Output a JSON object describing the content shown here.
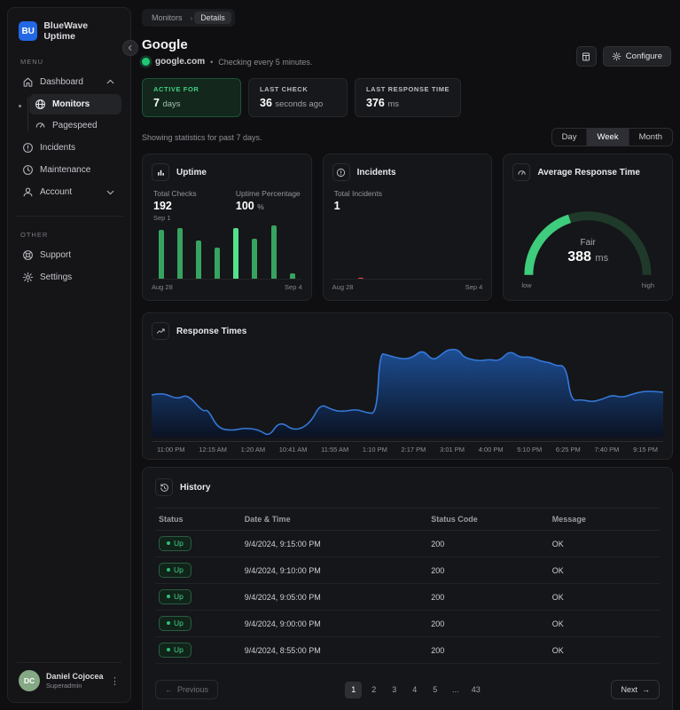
{
  "sidebar": {
    "logo_text": "BU",
    "brand": "BlueWave Uptime",
    "menu_label": "MENU",
    "other_label": "OTHER",
    "items": [
      {
        "label": "Dashboard"
      },
      {
        "label": "Monitors"
      },
      {
        "label": "Pagespeed"
      },
      {
        "label": "Incidents"
      },
      {
        "label": "Maintenance"
      },
      {
        "label": "Account"
      }
    ],
    "other_items": [
      {
        "label": "Support"
      },
      {
        "label": "Settings"
      }
    ],
    "user": {
      "initials": "DC",
      "name": "Daniel Cojocea",
      "role": "Superadmin"
    }
  },
  "header": {
    "breadcrumb": [
      "Monitors",
      "Details"
    ],
    "title": "Google",
    "host": "google.com",
    "separator": "•",
    "checking_note": "Checking every 5 minutes.",
    "configure_label": "Configure"
  },
  "stats": [
    {
      "label": "ACTIVE FOR",
      "value": "7",
      "unit": "days",
      "accent": true
    },
    {
      "label": "LAST CHECK",
      "value": "36",
      "unit": "seconds ago",
      "accent": false
    },
    {
      "label": "LAST RESPONSE TIME",
      "value": "376",
      "unit": "ms",
      "accent": false
    }
  ],
  "period": {
    "note": "Showing statistics for past 7 days.",
    "options": [
      "Day",
      "Week",
      "Month"
    ],
    "selected": "Week"
  },
  "cards": {
    "uptime": {
      "title": "Uptime",
      "total_checks_label": "Total Checks",
      "total_checks": "192",
      "uptime_pct_label": "Uptime Percentage",
      "uptime_pct": "100",
      "pct_unit": "%",
      "hover_label": "Sep 1",
      "x_start": "Aug 28",
      "x_end": "Sep 4"
    },
    "incidents": {
      "title": "Incidents",
      "total_label": "Total Incidents",
      "total": "1",
      "x_start": "Aug 28",
      "x_end": "Sep 4"
    },
    "avg_response": {
      "title": "Average Response Time",
      "status": "Fair",
      "value": "388",
      "unit": "ms",
      "low_label": "low",
      "high_label": "high"
    },
    "response_times": {
      "title": "Response Times"
    }
  },
  "chart_data": [
    {
      "id": "uptime-bars",
      "type": "bar",
      "title": "Uptime checks per day (relative bar height %)",
      "categories": [
        "Aug 28",
        "Aug 29",
        "Aug 30",
        "Aug 31",
        "Sep 1",
        "Sep 2",
        "Sep 3",
        "Sep 4"
      ],
      "values": [
        90,
        94,
        70,
        58,
        94,
        73,
        98,
        10
      ],
      "highlight_index": 4,
      "x_labels_shown": [
        "Aug 28",
        "Sep 4"
      ],
      "bar_color": "#37a361",
      "highlight_color": "#55e08d"
    },
    {
      "id": "incident-bars",
      "type": "bar",
      "title": "Incidents per day",
      "categories": [
        "Aug 28",
        "Aug 29",
        "Aug 30",
        "Aug 31",
        "Sep 1",
        "Sep 2",
        "Sep 3",
        "Sep 4"
      ],
      "values": [
        0,
        1,
        0,
        0,
        0,
        0,
        0,
        0
      ],
      "total_incidents": 1,
      "x_labels_shown": [
        "Aug 28",
        "Sep 4"
      ],
      "bar_color": "#ee4f44"
    },
    {
      "id": "response-gauge",
      "type": "gauge",
      "value": 388,
      "unit": "ms",
      "label": "Fair",
      "arc_fraction": 0.4,
      "ticks": [
        "low",
        "high"
      ],
      "bright_color": "#3ecd7c",
      "track_color": "#1f3a2a"
    },
    {
      "id": "response-area",
      "type": "area",
      "title": "Response Times",
      "x_ticks": [
        "11:00 PM",
        "12:15 AM",
        "1:20 AM",
        "10:41 AM",
        "11:55 AM",
        "1:10 PM",
        "2:17 PM",
        "3:01 PM",
        "4:00 PM",
        "5:10 PM",
        "6:25 PM",
        "7:40 PM",
        "9:15 PM"
      ],
      "y_range_note": "relative response level 0-100",
      "points": [
        [
          0,
          48
        ],
        [
          2,
          51
        ],
        [
          5,
          43
        ],
        [
          7,
          49
        ],
        [
          10,
          29
        ],
        [
          11,
          32
        ],
        [
          13,
          10
        ],
        [
          16,
          8
        ],
        [
          18,
          11
        ],
        [
          21,
          9
        ],
        [
          23,
          1
        ],
        [
          25,
          19
        ],
        [
          28,
          7
        ],
        [
          31,
          16
        ],
        [
          33,
          38
        ],
        [
          35,
          32
        ],
        [
          37,
          29
        ],
        [
          40,
          32
        ],
        [
          42,
          28
        ],
        [
          44,
          27
        ],
        [
          44.6,
          95
        ],
        [
          46,
          93
        ],
        [
          49,
          88
        ],
        [
          51,
          90
        ],
        [
          53,
          99
        ],
        [
          55,
          86
        ],
        [
          57,
          95
        ],
        [
          58,
          99
        ],
        [
          60,
          99
        ],
        [
          61,
          90
        ],
        [
          64,
          86
        ],
        [
          66,
          88
        ],
        [
          68,
          86
        ],
        [
          70,
          98
        ],
        [
          72,
          90
        ],
        [
          74,
          91
        ],
        [
          76,
          86
        ],
        [
          78,
          84
        ],
        [
          79,
          81
        ],
        [
          81,
          81
        ],
        [
          82,
          41
        ],
        [
          84,
          43
        ],
        [
          86,
          40
        ],
        [
          88,
          43
        ],
        [
          90,
          48
        ],
        [
          92,
          45
        ],
        [
          94,
          49
        ],
        [
          96,
          52
        ],
        [
          98,
          52
        ],
        [
          100,
          51
        ]
      ],
      "line_color": "#3579db",
      "fill_top": "#1d4e93",
      "fill_bottom": "#0b1222"
    }
  ],
  "history": {
    "title": "History",
    "columns": [
      "Status",
      "Date & Time",
      "Status Code",
      "Message"
    ],
    "rows": [
      {
        "status": "Up",
        "datetime": "9/4/2024, 9:15:00 PM",
        "code": "200",
        "message": "OK"
      },
      {
        "status": "Up",
        "datetime": "9/4/2024, 9:10:00 PM",
        "code": "200",
        "message": "OK"
      },
      {
        "status": "Up",
        "datetime": "9/4/2024, 9:05:00 PM",
        "code": "200",
        "message": "OK"
      },
      {
        "status": "Up",
        "datetime": "9/4/2024, 9:00:00 PM",
        "code": "200",
        "message": "OK"
      },
      {
        "status": "Up",
        "datetime": "9/4/2024, 8:55:00 PM",
        "code": "200",
        "message": "OK"
      }
    ],
    "pagination": {
      "prev_label": "Previous",
      "next_label": "Next",
      "prev_arrow": "←",
      "next_arrow": "→",
      "pages": [
        "1",
        "2",
        "3",
        "4",
        "5",
        "...",
        "43"
      ],
      "active_page": "1"
    }
  }
}
